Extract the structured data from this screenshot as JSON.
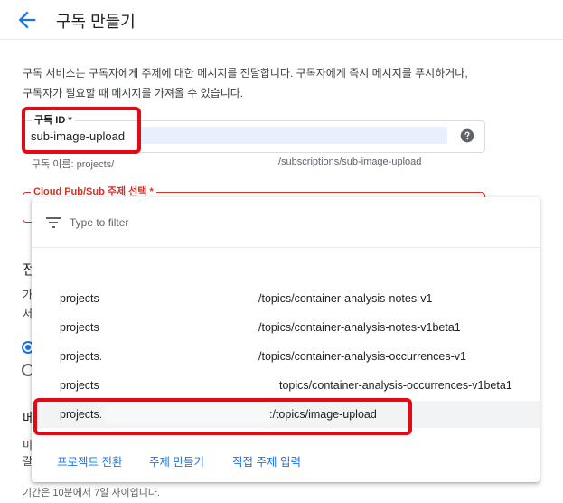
{
  "header": {
    "title": "구독 만들기"
  },
  "intro": {
    "line1": "구독 서비스는 구독자에게 주제에 대한 메시지를 전달합니다. 구독자에게 즉시 메시지를 푸시하거나,",
    "line2": "구독자가 필요할 때 메시지를 가져올 수 있습니다."
  },
  "subscription_field": {
    "label": "구독 ID *",
    "value": "sub-image-upload",
    "hint_prefix": "구독 이름: projects/",
    "hint_suffix": "/subscriptions/sub-image-upload"
  },
  "topic_field": {
    "label": "Cloud Pub/Sub 주제 선택 *"
  },
  "background_fragments": {
    "heading": "전",
    "text1": "가",
    "text2": "서",
    "heading2": "메",
    "text3": "미",
    "text4": "갈"
  },
  "bottom_note": "기간은 10분에서 7일 사이입니다.",
  "dropdown": {
    "filter_placeholder": "Type to filter",
    "options": [
      {
        "prefix": "projects",
        "suffix": "/topics/container-analysis-notes-v1"
      },
      {
        "prefix": "projects",
        "suffix": "/topics/container-analysis-notes-v1beta1"
      },
      {
        "prefix": "projects.",
        "suffix": "/topics/container-analysis-occurrences-v1"
      },
      {
        "prefix": "projects",
        "suffix": "topics/container-analysis-occurrences-v1beta1"
      },
      {
        "prefix": "projects.",
        "suffix": ":/topics/image-upload"
      }
    ],
    "footer": {
      "switch_project": "프로젝트 전환",
      "create_topic": "주제 만들기",
      "enter_topic": "직접 주제 입력"
    }
  },
  "colors": {
    "accent": "#1a73e8",
    "error": "#d93025",
    "callout": "#e50914"
  }
}
